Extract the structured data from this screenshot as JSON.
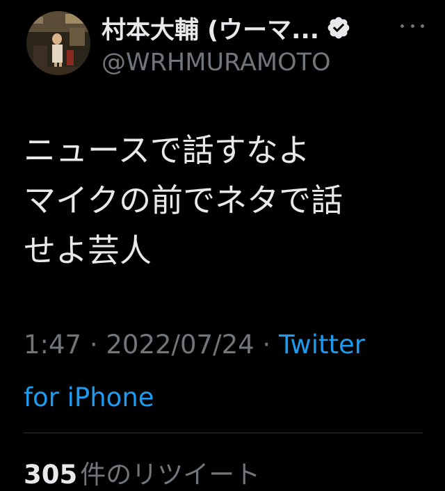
{
  "author": {
    "display_name": "村本大輔 (ウーマ...",
    "handle": "@WRHMURAMOTO",
    "verified": true,
    "avatar_icon": "profile-photo"
  },
  "header": {
    "more_icon": "ellipsis-icon"
  },
  "tweet": {
    "lines": [
      "ニュースで話すなよ",
      "マイクの前でネタで話",
      "せよ芸人"
    ],
    "time": "1:47",
    "separator": "·",
    "date": "2022/07/24",
    "source_line1": "Twitter",
    "source_line2": "for iPhone"
  },
  "stats": {
    "retweet_count": "305",
    "retweet_label": "件のリツイート"
  },
  "colors": {
    "background": "#000000",
    "text_primary": "#e7e9ea",
    "text_secondary": "#71767b",
    "link": "#1d9bf0",
    "divider": "#2f3336"
  }
}
